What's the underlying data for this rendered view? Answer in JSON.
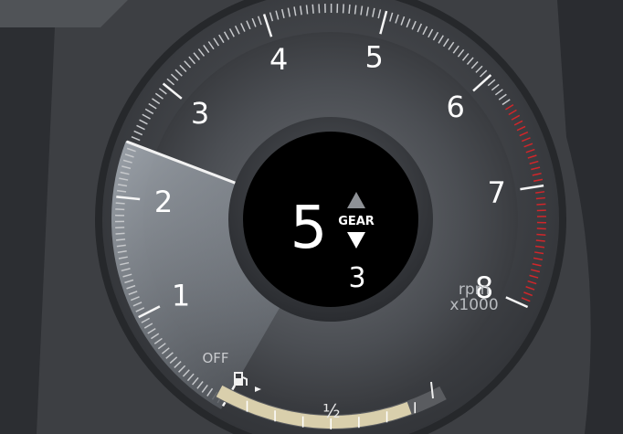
{
  "tachometer": {
    "ticks": [
      "1",
      "2",
      "3",
      "4",
      "5",
      "6",
      "7",
      "8"
    ],
    "off_label": "OFF",
    "unit_line1": "rpm",
    "unit_line2": "x1000",
    "needle_rpm": 2.45,
    "redline_start_rpm": 6.3
  },
  "gear": {
    "current": "5",
    "label": "GEAR",
    "recommended": "3",
    "up_arrow": "up-triangle-icon",
    "down_arrow": "down-triangle-icon"
  },
  "fuel": {
    "icon": "fuel-pump-icon",
    "arrow": "fuel-side-arrow-icon",
    "half_label": "½",
    "level": 0.85
  },
  "colors": {
    "redline": "#d1262a",
    "fuel_fill": "#d9cfac",
    "needle": "#f2f2f2",
    "digits": "#ffffff"
  }
}
